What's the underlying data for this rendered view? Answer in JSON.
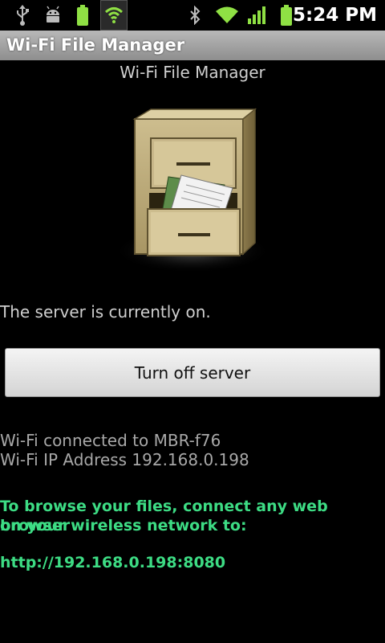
{
  "status_bar": {
    "time": "5:24 PM",
    "icons": [
      "usb-icon",
      "android-debug-icon",
      "battery-icon",
      "wifi-shield-icon",
      "bluetooth-icon",
      "wifi-signal-icon",
      "cell-signal-icon",
      "battery-full-icon"
    ]
  },
  "titlebar": {
    "title": "Wi-Fi File Manager"
  },
  "main": {
    "heading": "Wi-Fi File Manager",
    "server_status": "The server is currently on.",
    "toggle_button_label": "Turn off server",
    "wifi_connected": "Wi-Fi connected to MBR-f76",
    "wifi_ip": "Wi-Fi IP Address 192.168.0.198",
    "browse_line1": "To browse your files, connect any web browser",
    "browse_line2": "on your wireless network to:",
    "url": "http://192.168.0.198:8080"
  },
  "colors": {
    "background": "#000000",
    "accent_green": "#3ddc84",
    "titlebar": "#a0a0a0"
  }
}
